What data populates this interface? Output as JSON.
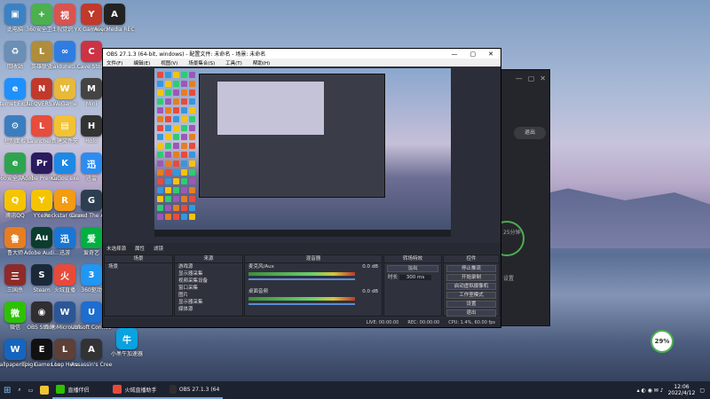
{
  "desktop_icons": [
    {
      "label": "此电脑",
      "color": "#3b82c4",
      "glyph": "▣"
    },
    {
      "label": "360安全卫士",
      "color": "#4caf50",
      "glyph": "+"
    },
    {
      "label": "视觉识",
      "color": "#d9534f",
      "glyph": "视"
    },
    {
      "label": "YX Gaming...",
      "color": "#c0392b",
      "glyph": "Y"
    },
    {
      "label": "AverMedia RECentral",
      "color": "#222",
      "glyph": "A"
    },
    {
      "label": "回收站",
      "color": "#6b8fb5",
      "glyph": "♻"
    },
    {
      "label": "英雄联盟",
      "color": "#b08d3a",
      "glyph": "L"
    },
    {
      "label": "baiduneti...",
      "color": "#2f7de1",
      "glyph": "∞"
    },
    {
      "label": "Cave Story",
      "color": "#c34",
      "glyph": "C"
    },
    {
      "label": "Internet Explorer",
      "color": "#1e90ff",
      "glyph": "e"
    },
    {
      "label": "NEOVERS...",
      "color": "#c0392b",
      "glyph": "N"
    },
    {
      "label": "WeGame",
      "color": "#e7b93b",
      "glyph": "W"
    },
    {
      "label": "Mini",
      "color": "#444",
      "glyph": "M"
    },
    {
      "label": "控制面板",
      "color": "#3a7ebf",
      "glyph": "⚙"
    },
    {
      "label": "Launcher...",
      "color": "#e74c3c",
      "glyph": "L"
    },
    {
      "label": "新建文件夹",
      "color": "#f1c232",
      "glyph": "▤"
    },
    {
      "label": "Holo",
      "color": "#333",
      "glyph": "H"
    },
    {
      "label": "360安全浏览器",
      "color": "#2ea44f",
      "glyph": "e"
    },
    {
      "label": "Adobe Premie...",
      "color": "#2a1a5e",
      "glyph": "Pr"
    },
    {
      "label": "KuGou.exe",
      "color": "#1e88e5",
      "glyph": "K"
    },
    {
      "label": "迅雷",
      "color": "#2d8cf0",
      "glyph": "迅"
    },
    {
      "label": "腾讯QQ",
      "color": "#f5c400",
      "glyph": "Q"
    },
    {
      "label": "YY.exe",
      "color": "#f5c400",
      "glyph": "Y"
    },
    {
      "label": "Rockstar Games...",
      "color": "#f39c12",
      "glyph": "R"
    },
    {
      "label": "Grand The Auto",
      "color": "#2c3e50",
      "glyph": "G"
    },
    {
      "label": "鲁大师",
      "color": "#e67e22",
      "glyph": "鲁"
    },
    {
      "label": "Adobe Audi...",
      "color": "#0b3d2e",
      "glyph": "Au"
    },
    {
      "label": "迅游",
      "color": "#1976d2",
      "glyph": "迅"
    },
    {
      "label": "爱奇艺",
      "color": "#00b140",
      "glyph": "爱"
    },
    {
      "label": "三国杀",
      "color": "#8e2a2a",
      "glyph": "三"
    },
    {
      "label": "Steam",
      "color": "#1b2838",
      "glyph": "S"
    },
    {
      "label": "火绒直播",
      "color": "#e84a3a",
      "glyph": "火"
    },
    {
      "label": "360驱动",
      "color": "#2196f3",
      "glyph": "3"
    },
    {
      "label": "微信",
      "color": "#2dc100",
      "glyph": "微"
    },
    {
      "label": "OBS Studio",
      "color": "#302e31",
      "glyph": "◉"
    },
    {
      "label": "新建 Microsoft...",
      "color": "#2b5797",
      "glyph": "W"
    },
    {
      "label": "Ubisoft Connect",
      "color": "#1e6dd1",
      "glyph": "U"
    },
    {
      "label": "Wallpaper Engine",
      "color": "#1565c0",
      "glyph": "W"
    },
    {
      "label": "Epic Games Launcher",
      "color": "#111",
      "glyph": "E"
    },
    {
      "label": "Loop Hero",
      "color": "#5d4037",
      "glyph": "L"
    },
    {
      "label": "Assassin's Creed O...",
      "color": "#333",
      "glyph": "A"
    },
    {
      "label": "小黑牛加速器",
      "color": "#0aa2e0",
      "glyph": "牛"
    }
  ],
  "obs": {
    "title": "OBS 27.1.3 (64-bit, windows) - 配置文件: 未命名 - 场景: 未命名",
    "menu": [
      "文件(F)",
      "编辑(E)",
      "视图(V)",
      "场景集合(S)",
      "工具(T)",
      "帮助(H)"
    ],
    "subbar": [
      "未选择源",
      "属性",
      "滤镜"
    ],
    "docks": {
      "scenes": "场景",
      "sources": "来源",
      "mixer": "混音器",
      "transitions": "转场特效",
      "controls": "控件"
    },
    "scene_items": [
      "场景"
    ],
    "source_items": [
      "游戏源",
      "显示器采集",
      "视频采集设备",
      "窗口采集",
      "图片",
      "显示器采集",
      "媒体源"
    ],
    "mixer_tracks": [
      {
        "name": "麦克风/Aux",
        "db": "0.0 dB"
      },
      {
        "name": "桌面音频",
        "db": "0.0 dB"
      }
    ],
    "transition": {
      "type": "淡出",
      "duration_label": "时长",
      "duration": "300 ms"
    },
    "controls": [
      "停止推流",
      "开始录制",
      "启动虚拟摄像机",
      "工作室模式",
      "设置",
      "退出"
    ],
    "status": [
      "LIVE: 00:00:00",
      "REC: 00:00:00",
      "CPU: 1.4%, 60.00 fps"
    ]
  },
  "bgapp": {
    "button": "退出",
    "ring_label": "25分钟",
    "right_label": "设置"
  },
  "badge": "29%",
  "taskbar": {
    "tasks": [
      "直播伴侣",
      "火绒直播助手",
      "OBS 27.1.3 (64-bit..."
    ],
    "time": "12:06",
    "date": "2022/4/12"
  }
}
